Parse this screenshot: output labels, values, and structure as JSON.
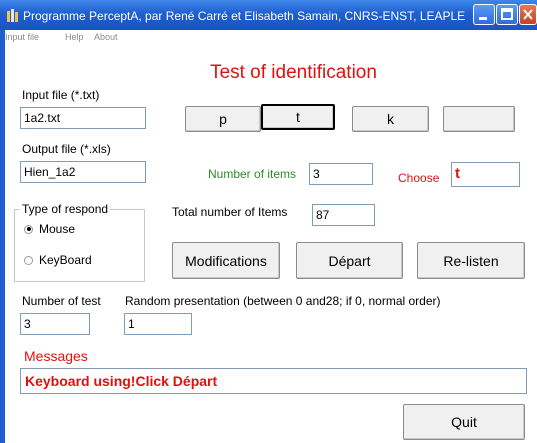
{
  "window": {
    "title": "Programme PerceptA, par René Carré et Elisabeth Samain, CNRS-ENST, LEAPLE"
  },
  "menu": [
    "Input file",
    "Help",
    "About"
  ],
  "heading": "Test of identification",
  "input_file": {
    "label": "Input file (*.txt)",
    "value": "1a2.txt"
  },
  "output_file": {
    "label": "Output file (*.xls)",
    "value": "Hien_1a2"
  },
  "phoneme_buttons": [
    "p",
    "t",
    "k",
    ""
  ],
  "number_of_items": {
    "label": "Number of items",
    "value": "3"
  },
  "choose": {
    "label": "Choose",
    "value": "t"
  },
  "total_items": {
    "label": "Total number of Items",
    "value": "87"
  },
  "respond": {
    "title": "Type of respond",
    "options": [
      "Mouse",
      "KeyBoard"
    ],
    "selected": "Mouse"
  },
  "actions": {
    "modifications": "Modifications",
    "depart": "Départ",
    "relisten": "Re-listen",
    "quit": "Quit"
  },
  "number_of_test": {
    "label": "Number of test",
    "value": "3"
  },
  "random_presentation": {
    "label": "Random presentation (between 0 and28; if 0, normal order)",
    "value": "1"
  },
  "messages": {
    "label": "Messages",
    "value": "Keyboard using!Click Départ"
  },
  "colors": {
    "title_bar": "#1f5fd0",
    "accent_red": "#e01010",
    "accent_green": "#2e8b2e"
  }
}
